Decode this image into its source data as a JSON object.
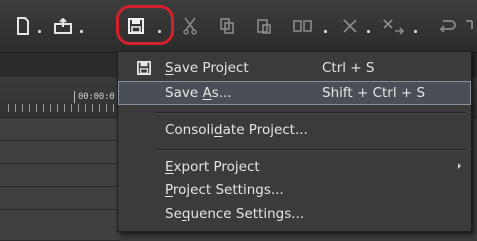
{
  "toolbar": {
    "icons": [
      "new-project-icon",
      "open-project-icon",
      "save-project-icon",
      "cut-icon",
      "copy-icon",
      "paste-icon",
      "paste-insert-icon",
      "delete-icon",
      "ripple-delete-icon",
      "undo-icon"
    ]
  },
  "timeline": {
    "ruler_time": "00:00:0"
  },
  "menu": {
    "items": [
      {
        "pre": "",
        "ul": "S",
        "post": "ave Project",
        "shortcut": "Ctrl + S"
      },
      {
        "pre": "Save ",
        "ul": "A",
        "post": "s...",
        "shortcut": "Shift + Ctrl + S"
      },
      {
        "pre": "Consoli",
        "ul": "d",
        "post": "ate Project..."
      },
      {
        "pre": "",
        "ul": "E",
        "post": "xport Project"
      },
      {
        "pre": "",
        "ul": "P",
        "post": "roject Settings..."
      },
      {
        "pre": "Se",
        "ul": "q",
        "post": "uence Settings..."
      }
    ]
  },
  "colors": {
    "highlight_ring": "#d2212a",
    "menu_bg": "#3b3b3b",
    "hover_bg": "#4a4f57"
  }
}
